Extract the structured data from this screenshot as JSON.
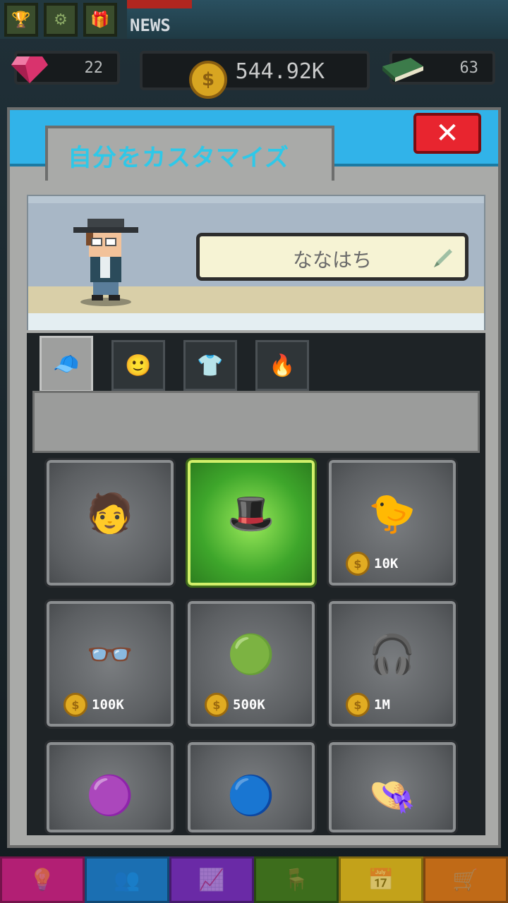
{
  "topbar": {
    "icons": [
      "trophy-icon",
      "gear-icon",
      "gift-icon"
    ],
    "news_label": "NEWS"
  },
  "resources": {
    "gems": "22",
    "coins": "544.92K",
    "books": "63"
  },
  "dialog": {
    "title": "自分をカスタマイズ",
    "close_label": "✕",
    "player_name": "ななはち"
  },
  "tabs": [
    {
      "name": "hat",
      "icon": "hat-icon",
      "glyph": "🧢"
    },
    {
      "name": "face",
      "icon": "face-icon",
      "glyph": "🙂"
    },
    {
      "name": "shirt",
      "icon": "shirt-icon",
      "glyph": "👕"
    },
    {
      "name": "effect",
      "icon": "fire-icon",
      "glyph": "🔥"
    }
  ],
  "items": [
    {
      "icon": "hair-icon",
      "glyph": "🧑",
      "price": ""
    },
    {
      "icon": "fedora-icon",
      "glyph": "🎩",
      "price": ""
    },
    {
      "icon": "duck-hat-icon",
      "glyph": "🐤",
      "price": "10K"
    },
    {
      "icon": "glasses-icon",
      "glyph": "👓",
      "price": "100K"
    },
    {
      "icon": "beret-icon",
      "glyph": "🟢",
      "price": "500K"
    },
    {
      "icon": "earbud-icon",
      "glyph": "🎧",
      "price": "1M"
    },
    {
      "icon": "purple-cap-icon",
      "glyph": "🟣",
      "price": ""
    },
    {
      "icon": "blue-cap-icon",
      "glyph": "🔵",
      "price": ""
    },
    {
      "icon": "straw-hat-icon",
      "glyph": "👒",
      "price": ""
    }
  ],
  "bottom_nav": [
    {
      "icon": "lightbulb-icon",
      "glyph": "💡",
      "color": "#b21f74"
    },
    {
      "icon": "team-icon",
      "glyph": "👥",
      "color": "#1b6fb2"
    },
    {
      "icon": "chart-icon",
      "glyph": "📈",
      "color": "#6a2aa6"
    },
    {
      "icon": "chair-icon",
      "glyph": "🪑",
      "color": "#3d6d1c"
    },
    {
      "icon": "calendar-icon",
      "glyph": "📅",
      "color": "#c3a21a"
    },
    {
      "icon": "cart-icon",
      "glyph": "🛒",
      "color": "#c06a17"
    }
  ]
}
